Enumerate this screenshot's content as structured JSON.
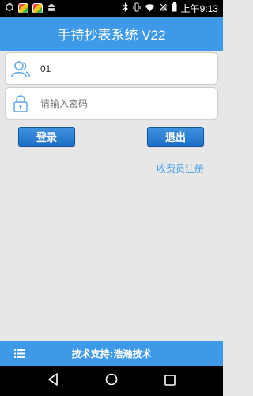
{
  "status_bar": {
    "time": "上午9:13"
  },
  "header": {
    "title": "手持抄表系统 V22"
  },
  "login": {
    "username_value": "01",
    "password_placeholder": "请输入密码",
    "login_label": "登录",
    "exit_label": "退出",
    "register_label": "收费员注册"
  },
  "footer": {
    "support": "技术支持:浩瀚技术"
  },
  "colors": {
    "accent": "#3e9ae8",
    "button": "#1e6fc4",
    "background": "#e7e7e7"
  }
}
